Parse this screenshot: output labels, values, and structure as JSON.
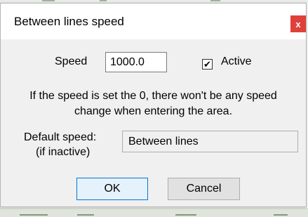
{
  "dialog": {
    "title": "Between lines speed",
    "close_label": "x",
    "speed_label": "Speed",
    "speed_value": "1000.0",
    "active_checked": true,
    "active_label": "Active",
    "info_text": "If the speed is set the 0, there won't be any speed change when entering the area.",
    "default_speed_label": "Default speed:",
    "default_speed_sublabel": "(if inactive)",
    "default_speed_value": "Between lines",
    "ok_label": "OK",
    "cancel_label": "Cancel"
  },
  "colors": {
    "close_button": "#e0403a",
    "dialog_background": "#f0f0f0",
    "ok_border": "#0078d7"
  },
  "icons": {
    "checkbox_mark": "checkmark-icon"
  }
}
